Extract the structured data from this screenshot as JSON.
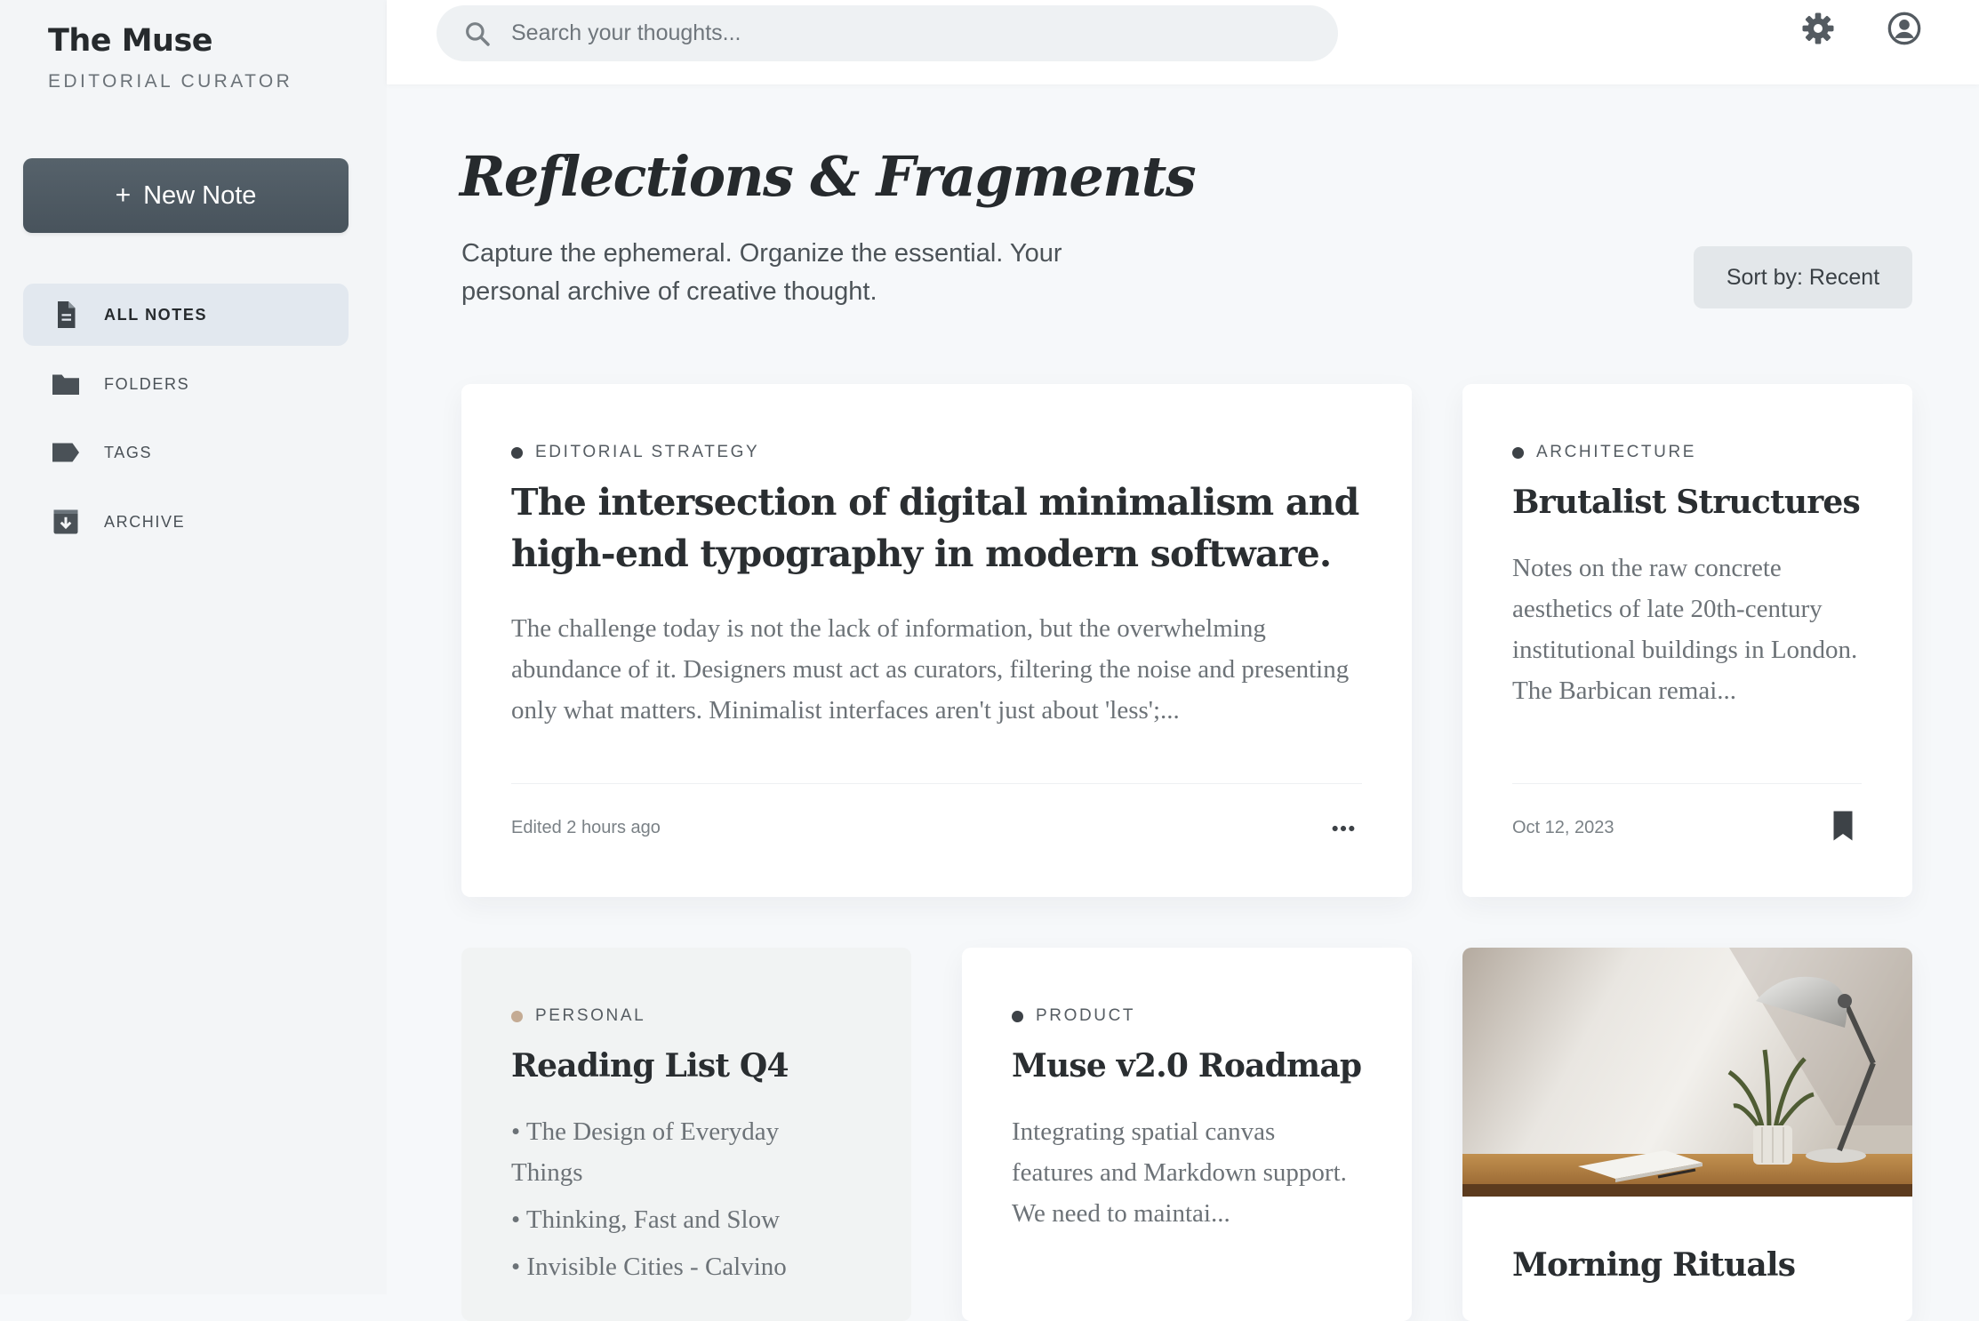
{
  "brand": {
    "title": "The Muse",
    "subtitle": "EDITORIAL CURATOR"
  },
  "new_note": {
    "plus": "+",
    "label": "New Note"
  },
  "nav": [
    {
      "label": "ALL NOTES",
      "icon": "document-icon",
      "active": true
    },
    {
      "label": "FOLDERS",
      "icon": "folder-icon",
      "active": false
    },
    {
      "label": "TAGS",
      "icon": "tag-icon",
      "active": false
    },
    {
      "label": "ARCHIVE",
      "icon": "archive-icon",
      "active": false
    }
  ],
  "search": {
    "placeholder": "Search your thoughts...",
    "value": ""
  },
  "header": {
    "title": "Reflections & Fragments",
    "description": "Capture the ephemeral. Organize the essential. Your personal archive of creative thought.",
    "sort_label": "Sort by: Recent"
  },
  "cards": [
    {
      "tag": "EDITORIAL STRATEGY",
      "tag_color": "#3d4247",
      "title": "The intersection of digital minimalism and high-end typography in modern software.",
      "body": "The challenge today is not the lack of information, but the overwhelming abundance of it. Designers must act as curators, filtering the noise and presenting only what matters. Minimalist interfaces aren't just about 'less';...",
      "meta": "Edited 2 hours ago",
      "action_icon": "more-horizontal-icon"
    },
    {
      "tag": "ARCHITECTURE",
      "tag_color": "#3d4247",
      "title": "Brutalist Structures",
      "body": "Notes on the raw concrete aesthetics of late 20th-century institutional buildings in London. The Barbican remai...",
      "meta": "Oct 12, 2023",
      "action_icon": "bookmark-icon"
    },
    {
      "tag": "PERSONAL",
      "tag_color": "#c4ab94",
      "title": "Reading List Q4",
      "list": [
        "• The Design of Everyday Things",
        "• Thinking, Fast and Slow",
        "• Invisible Cities - Calvino"
      ]
    },
    {
      "tag": "PRODUCT",
      "tag_color": "#3d4247",
      "title": "Muse v2.0 Roadmap",
      "body": "Integrating spatial canvas features and Markdown support. We need to maintai..."
    },
    {
      "image": "desk-lamp-plant-photo",
      "title": "Morning Rituals"
    }
  ],
  "colors": {
    "accent": "#4f5b64",
    "sidebar_bg": "#f3f5f7",
    "active_nav_bg": "#e2e8ef",
    "personal_dot": "#c4ab94"
  }
}
